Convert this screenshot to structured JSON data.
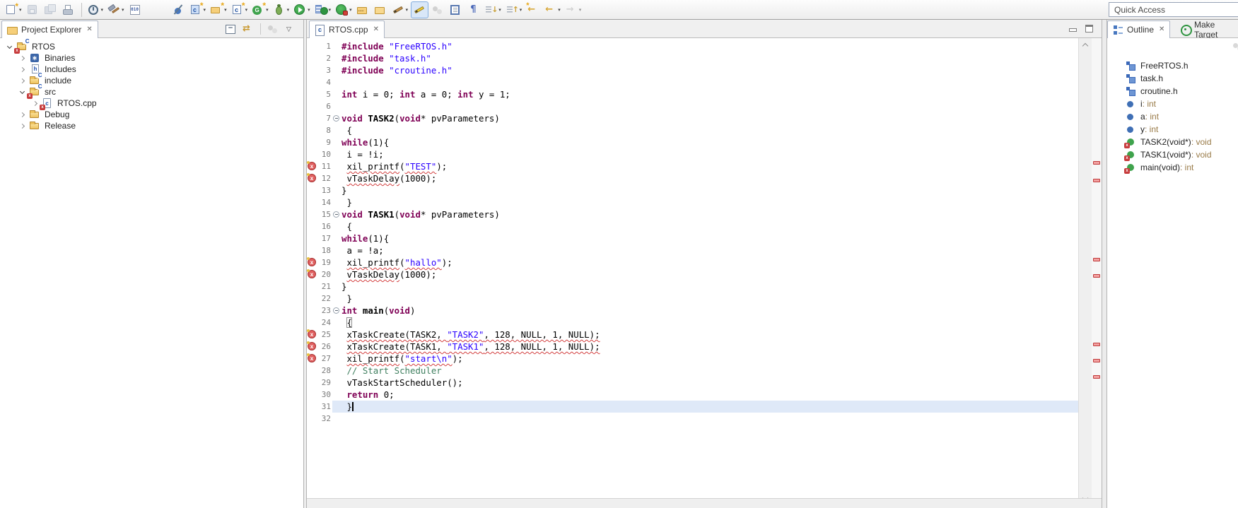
{
  "quick_access": {
    "label": "Quick Access"
  },
  "toolbar": {
    "items": [
      {
        "name": "new-wizard",
        "icon": "new",
        "dd": 1
      },
      {
        "name": "save",
        "icon": "save",
        "dim": 1
      },
      {
        "name": "save-all",
        "icon": "save-all",
        "dim": 1
      },
      {
        "name": "print",
        "icon": "print"
      },
      {
        "sep": 1
      },
      {
        "name": "launch-target",
        "icon": "clock",
        "dd": 1
      },
      {
        "name": "build",
        "icon": "hammer",
        "dd": 1
      },
      {
        "name": "create-binary",
        "icon": "binary"
      },
      {
        "gap": 1
      },
      {
        "name": "skip-all-breakpoints",
        "icon": "skip-bp"
      },
      {
        "name": "new-c-project",
        "icon": "c-doc-new",
        "dd": 1
      },
      {
        "name": "new-project",
        "icon": "folder-new",
        "dd": 1
      },
      {
        "name": "new-c-source-file",
        "icon": "c-doc-new2",
        "dd": 1
      },
      {
        "name": "generate-wizard",
        "icon": "g-circle",
        "dd": 1
      },
      {
        "name": "debug",
        "icon": "bug",
        "dd": 1
      },
      {
        "name": "run",
        "icon": "play",
        "dd": 1
      },
      {
        "name": "run-history",
        "icon": "play-list",
        "dd": 1
      },
      {
        "name": "profile",
        "icon": "play-red",
        "dd": 1
      },
      {
        "name": "open-resource",
        "icon": "folder-dots"
      },
      {
        "name": "open-file",
        "icon": "folder-open"
      },
      {
        "name": "pencil",
        "icon": "pencil",
        "dd": 1
      },
      {
        "name": "mark-occurrences",
        "icon": "highlighter",
        "sel": 1
      },
      {
        "name": "dimmed-circles",
        "icon": "circles",
        "dim": 1
      },
      {
        "name": "show-source",
        "icon": "source"
      },
      {
        "name": "show-whitespace",
        "icon": "pilcrow"
      },
      {
        "name": "next-annotation",
        "icon": "down-list",
        "dd": 1
      },
      {
        "name": "previous-annotation",
        "icon": "up-list",
        "dd": 1
      },
      {
        "name": "last-edit-location",
        "icon": "back-star"
      },
      {
        "name": "back",
        "icon": "back",
        "dd": 1
      },
      {
        "name": "forward",
        "icon": "forward",
        "dim": 1,
        "dd": 1
      }
    ]
  },
  "project_explorer": {
    "title": "Project Explorer",
    "items": [
      {
        "level": 0,
        "chev": "open",
        "shape": "folder",
        "badges": [
          "c",
          "x"
        ],
        "label": "RTOS"
      },
      {
        "level": 1,
        "chev": "closed",
        "shape": "bin",
        "letter": "∗",
        "label": "Binaries"
      },
      {
        "level": 1,
        "chev": "closed",
        "shape": "docs",
        "letter": "h",
        "label": "Includes"
      },
      {
        "level": 1,
        "chev": "closed",
        "shape": "folder",
        "badges": [
          "c"
        ],
        "label": "include"
      },
      {
        "level": 1,
        "chev": "open",
        "shape": "folder",
        "badges": [
          "c",
          "x"
        ],
        "label": "src"
      },
      {
        "level": 2,
        "chev": "closed",
        "shape": "doc",
        "letter": "c",
        "badges": [
          "x"
        ],
        "label": "RTOS.cpp"
      },
      {
        "level": 1,
        "chev": "closed",
        "shape": "folder",
        "badges": [],
        "label": "Debug"
      },
      {
        "level": 1,
        "chev": "closed",
        "shape": "folder",
        "badges": [],
        "label": "Release"
      }
    ]
  },
  "editor": {
    "tab": "RTOS.cpp",
    "current_line": 31,
    "overview_marker_ys": [
      174,
      199,
      311,
      334,
      431,
      454,
      477
    ],
    "lines": [
      {
        "n": 1,
        "t": [
          {
            "s": "#include ",
            "c": "pp"
          },
          {
            "s": "\"FreeRTOS.h\"",
            "c": "str"
          }
        ]
      },
      {
        "n": 2,
        "t": [
          {
            "s": "#include ",
            "c": "pp"
          },
          {
            "s": "\"task.h\"",
            "c": "str"
          }
        ]
      },
      {
        "n": 3,
        "t": [
          {
            "s": "#include ",
            "c": "pp"
          },
          {
            "s": "\"croutine.h\"",
            "c": "str"
          }
        ]
      },
      {
        "n": 4,
        "t": []
      },
      {
        "n": 5,
        "t": [
          {
            "s": "int",
            "c": "kw"
          },
          {
            "s": " i = 0; ",
            "c": "pl"
          },
          {
            "s": "int",
            "c": "kw"
          },
          {
            "s": " a = 0; ",
            "c": "pl"
          },
          {
            "s": "int",
            "c": "kw"
          },
          {
            "s": " y = 1;",
            "c": "pl"
          }
        ]
      },
      {
        "n": 6,
        "t": []
      },
      {
        "n": 7,
        "fold": 1,
        "t": [
          {
            "s": "void",
            "c": "kw"
          },
          {
            "s": " ",
            "c": "pl"
          },
          {
            "s": "TASK2",
            "c": "fn"
          },
          {
            "s": "(",
            "c": "pl"
          },
          {
            "s": "void",
            "c": "kw"
          },
          {
            "s": "* pvParameters)",
            "c": "pl"
          }
        ]
      },
      {
        "n": 8,
        "t": [
          {
            "s": " {",
            "c": "pl"
          }
        ]
      },
      {
        "n": 9,
        "t": [
          {
            "s": "while",
            "c": "kw"
          },
          {
            "s": "(1){",
            "c": "pl"
          }
        ]
      },
      {
        "n": 10,
        "t": [
          {
            "s": " i = !i;",
            "c": "pl"
          }
        ]
      },
      {
        "n": 11,
        "err": 1,
        "t": [
          {
            "s": " ",
            "c": "pl"
          },
          {
            "s": "xil_printf",
            "c": "pl",
            "q": 1
          },
          {
            "s": "(",
            "c": "pl"
          },
          {
            "s": "\"TEST\"",
            "c": "str",
            "q": 1
          },
          {
            "s": ");",
            "c": "pl"
          }
        ]
      },
      {
        "n": 12,
        "err": 1,
        "t": [
          {
            "s": " ",
            "c": "pl"
          },
          {
            "s": "vTaskDelay",
            "c": "pl",
            "q": 1
          },
          {
            "s": "(1000);",
            "c": "pl"
          }
        ]
      },
      {
        "n": 13,
        "t": [
          {
            "s": "}",
            "c": "pl"
          }
        ]
      },
      {
        "n": 14,
        "t": [
          {
            "s": " }",
            "c": "pl"
          }
        ]
      },
      {
        "n": 15,
        "fold": 1,
        "t": [
          {
            "s": "void",
            "c": "kw"
          },
          {
            "s": " ",
            "c": "pl"
          },
          {
            "s": "TASK1",
            "c": "fn"
          },
          {
            "s": "(",
            "c": "pl"
          },
          {
            "s": "void",
            "c": "kw"
          },
          {
            "s": "* pvParameters)",
            "c": "pl"
          }
        ]
      },
      {
        "n": 16,
        "t": [
          {
            "s": " {",
            "c": "pl"
          }
        ]
      },
      {
        "n": 17,
        "t": [
          {
            "s": "while",
            "c": "kw"
          },
          {
            "s": "(1){",
            "c": "pl"
          }
        ]
      },
      {
        "n": 18,
        "t": [
          {
            "s": " a = !a;",
            "c": "pl"
          }
        ]
      },
      {
        "n": 19,
        "err": 1,
        "t": [
          {
            "s": " ",
            "c": "pl"
          },
          {
            "s": "xil_printf",
            "c": "pl",
            "q": 1
          },
          {
            "s": "(",
            "c": "pl"
          },
          {
            "s": "\"hallo\"",
            "c": "str",
            "q": 1
          },
          {
            "s": ");",
            "c": "pl"
          }
        ]
      },
      {
        "n": 20,
        "err": 1,
        "t": [
          {
            "s": " ",
            "c": "pl"
          },
          {
            "s": "vTaskDelay",
            "c": "pl",
            "q": 1
          },
          {
            "s": "(1000);",
            "c": "pl"
          }
        ]
      },
      {
        "n": 21,
        "t": [
          {
            "s": "}",
            "c": "pl"
          }
        ]
      },
      {
        "n": 22,
        "t": [
          {
            "s": " }",
            "c": "pl"
          }
        ]
      },
      {
        "n": 23,
        "fold": 1,
        "t": [
          {
            "s": "int",
            "c": "kw"
          },
          {
            "s": " ",
            "c": "pl"
          },
          {
            "s": "main",
            "c": "fn"
          },
          {
            "s": "(",
            "c": "pl"
          },
          {
            "s": "void",
            "c": "kw"
          },
          {
            "s": ")",
            "c": "pl"
          }
        ]
      },
      {
        "n": 24,
        "t": [
          {
            "s": " ",
            "c": "pl"
          },
          {
            "s": "{",
            "c": "brk"
          }
        ]
      },
      {
        "n": 25,
        "err": 1,
        "t": [
          {
            "s": " ",
            "c": "pl"
          },
          {
            "s": "xTaskCreate(TASK2, ",
            "c": "pl",
            "q": 1
          },
          {
            "s": "\"TASK2\"",
            "c": "str",
            "q": 1
          },
          {
            "s": ", 128, NULL, 1, NULL);",
            "c": "pl",
            "q": 1
          }
        ]
      },
      {
        "n": 26,
        "err": 1,
        "t": [
          {
            "s": " ",
            "c": "pl"
          },
          {
            "s": "xTaskCreate(TASK1, ",
            "c": "pl",
            "q": 1
          },
          {
            "s": "\"TASK1\"",
            "c": "str",
            "q": 1
          },
          {
            "s": ", 128, NULL, 1, NULL);",
            "c": "pl",
            "q": 1
          }
        ]
      },
      {
        "n": 27,
        "err": 1,
        "t": [
          {
            "s": " ",
            "c": "pl"
          },
          {
            "s": "xil_printf",
            "c": "pl",
            "q": 1
          },
          {
            "s": "(",
            "c": "pl"
          },
          {
            "s": "\"start\\n\"",
            "c": "str",
            "q": 1
          },
          {
            "s": ");",
            "c": "pl"
          }
        ]
      },
      {
        "n": 28,
        "t": [
          {
            "s": " ",
            "c": "pl"
          },
          {
            "s": "// Start Scheduler",
            "c": "com"
          }
        ]
      },
      {
        "n": 29,
        "t": [
          {
            "s": " vTaskStartScheduler();",
            "c": "pl"
          }
        ]
      },
      {
        "n": 30,
        "t": [
          {
            "s": " ",
            "c": "pl"
          },
          {
            "s": "return",
            "c": "kw"
          },
          {
            "s": " 0;",
            "c": "pl"
          }
        ]
      },
      {
        "n": 31,
        "cur": 1,
        "t": [
          {
            "s": " }",
            "c": "pl"
          }
        ]
      },
      {
        "n": 32,
        "t": []
      }
    ]
  },
  "outline": {
    "title": "Outline",
    "make_target_title": "Make Target",
    "items": [
      {
        "icon": "inc",
        "label": "FreeRTOS.h",
        "type": ""
      },
      {
        "icon": "inc",
        "label": "task.h",
        "type": ""
      },
      {
        "icon": "inc",
        "label": "croutine.h",
        "type": ""
      },
      {
        "icon": "var",
        "label": "i",
        "type": " : int"
      },
      {
        "icon": "var",
        "label": "a",
        "type": " : int"
      },
      {
        "icon": "var",
        "label": "y",
        "type": " : int"
      },
      {
        "icon": "fn-err",
        "label": "TASK2(void*)",
        "type": " : void"
      },
      {
        "icon": "fn-err",
        "label": "TASK1(void*)",
        "type": " : void"
      },
      {
        "icon": "fn-err",
        "label": "main(void)",
        "type": " : int"
      }
    ]
  }
}
